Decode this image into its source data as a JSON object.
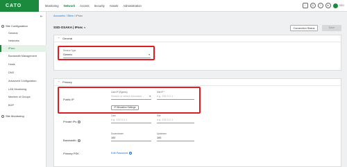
{
  "app": {
    "logo": "CATO"
  },
  "top_nav": [
    "Monitoring",
    "Network",
    "Access",
    "Security",
    "Assets",
    "Administration"
  ],
  "top_nav_active": "Network",
  "top_icons": [
    "alert-icon",
    "clock-icon",
    "help-icon",
    "notification-icon",
    "user-avatar"
  ],
  "user_initials": "SSO",
  "sidebar": {
    "groups": [
      {
        "label": "Site Configuration",
        "items": [
          "General",
          "Networks",
          "IPsec",
          "Bandwidth Management",
          "Hosts",
          "DNS",
          "Advanced Configuration",
          "LAN Monitoring",
          "Member of Groups",
          "BGP"
        ]
      },
      {
        "label": "Site Monitoring",
        "items": []
      }
    ],
    "active_item": "IPsec"
  },
  "breadcrumb": {
    "parts": [
      "Accounts",
      "Sites",
      "IPsec"
    ],
    "separator": "/"
  },
  "page": {
    "title": "SSD-OSAKA | IPsec",
    "title_caret": "▼"
  },
  "buttons": {
    "connection_status": "Connection Status",
    "save": "Save"
  },
  "general_panel": {
    "heading": "General",
    "service_type_label": "Service Type",
    "service_type_value": "Generic"
  },
  "primary_panel": {
    "heading": "Primary",
    "public_ip_label": "Public IP",
    "cato_ip_label": "Cato IP (Egress)",
    "cato_ip_placeholder": "Search or select Allocated ...",
    "site_ip_label": "Site IP *",
    "site_ip_placeholder": "e.g. 192.0.2.1",
    "ip_allocation_button": "IP Allocation Settings",
    "private_ips_label": "Private IPs",
    "private_cato_label": "Cato",
    "private_cato_placeholder": "e.g. 192.0.2.1",
    "private_site_label": "Site",
    "private_site_placeholder": "e.g. 192.0.2.1",
    "bandwidth_label": "Bandwidth",
    "downstream_label": "Downstream",
    "downstream_value": "100",
    "upstream_label": "Upstream",
    "upstream_value": "100",
    "psk_label": "Primary PSK",
    "psk_link": "Edit Password"
  },
  "colors": {
    "brand": "#1b8a3d",
    "highlight": "#e01b24",
    "link": "#1a73c7"
  }
}
